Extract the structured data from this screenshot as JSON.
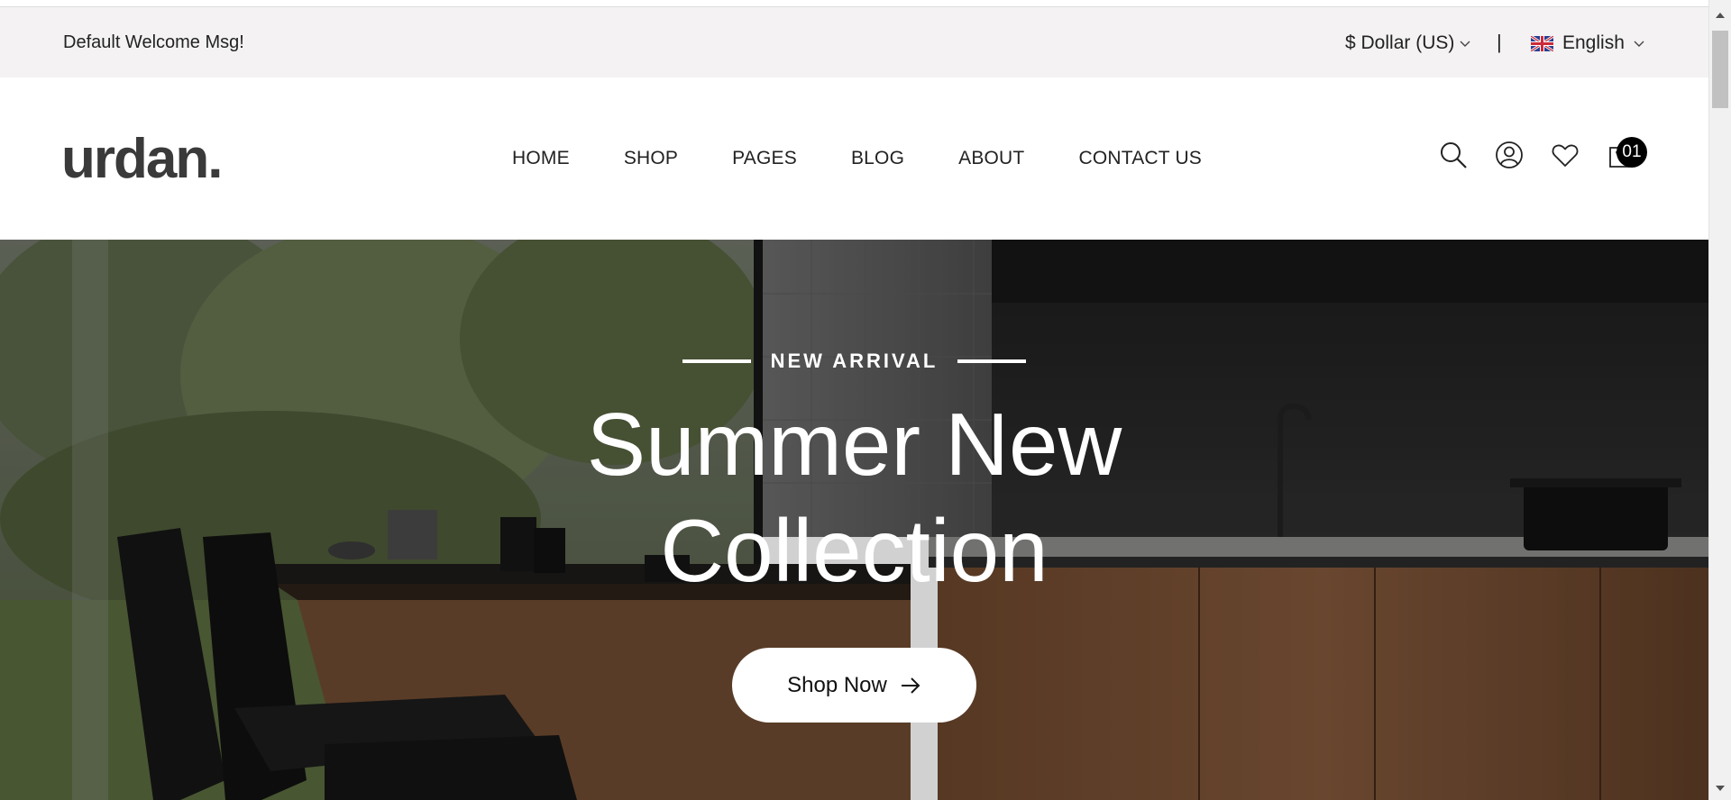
{
  "topbar": {
    "welcome": "Default Welcome Msg!",
    "currency": "$ Dollar (US)",
    "separator": "|",
    "language": "English"
  },
  "header": {
    "logo": "urdan.",
    "nav": [
      "HOME",
      "SHOP",
      "PAGES",
      "BLOG",
      "ABOUT",
      "CONTACT US"
    ],
    "cart_count": "01",
    "icons": [
      "search-icon",
      "account-icon",
      "heart-icon",
      "cart-icon"
    ]
  },
  "hero": {
    "eyebrow": "NEW ARRIVAL",
    "title_line1": "Summer New",
    "title_line2": "Collection",
    "cta": "Shop Now"
  },
  "colors": {
    "topbar_bg": "#f4f2f2",
    "badge_bg": "#000000",
    "text": "#222222"
  }
}
